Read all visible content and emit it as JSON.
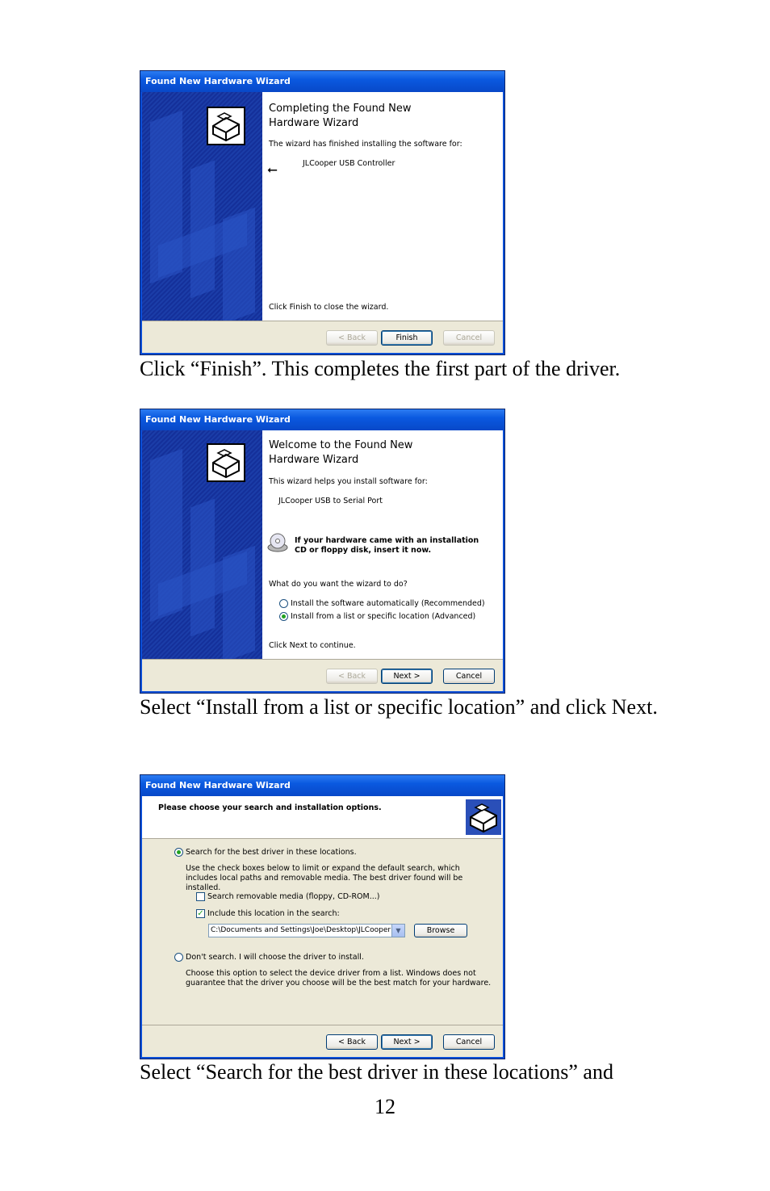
{
  "wizard_title": "Found New Hardware Wizard",
  "buttons": {
    "back": "< Back",
    "finish": "Finish",
    "next": "Next >",
    "cancel": "Cancel",
    "browse": "Browse"
  },
  "wizard1": {
    "heading": "Completing the Found New Hardware Wizard",
    "finished_text": "The wizard has finished installing the software for:",
    "device": "JLCooper USB Controller",
    "close_text": "Click Finish to close the wizard."
  },
  "caption1": "Click “Finish”.  This completes the first part of the driver.",
  "wizard2": {
    "heading": "Welcome to the Found New Hardware Wizard",
    "helps_text": "This wizard helps you install software for:",
    "device": "JLCooper USB to Serial Port",
    "cd_text": "If your hardware came with an installation CD or floppy disk, insert it now.",
    "question": "What do you want the wizard to do?",
    "option_auto": "Install the software automatically (Recommended)",
    "option_list": "Install from a list or specific location (Advanced)",
    "continue_text": "Click Next to continue."
  },
  "caption2": "Select “Install from a list or specific location” and click Next.",
  "wizard3": {
    "heading": "Please choose your search and installation options.",
    "option_search": "Search for the best driver in these locations.",
    "search_desc": "Use the check boxes below to limit or expand the default search, which includes local paths and removable media. The best driver found will be installed.",
    "check_removable": "Search removable media (floppy, CD-ROM...)",
    "check_include": "Include this location in the search:",
    "location": "C:\\Documents and Settings\\Joe\\Desktop\\JLCooper",
    "option_dont": "Don't search. I will choose the driver to install.",
    "dont_desc": "Choose this option to select the device driver from a list.  Windows does not guarantee that the driver you choose will be the best match for your hardware."
  },
  "caption3": "Select “Search for the best driver in these locations” and",
  "page_number": "12"
}
